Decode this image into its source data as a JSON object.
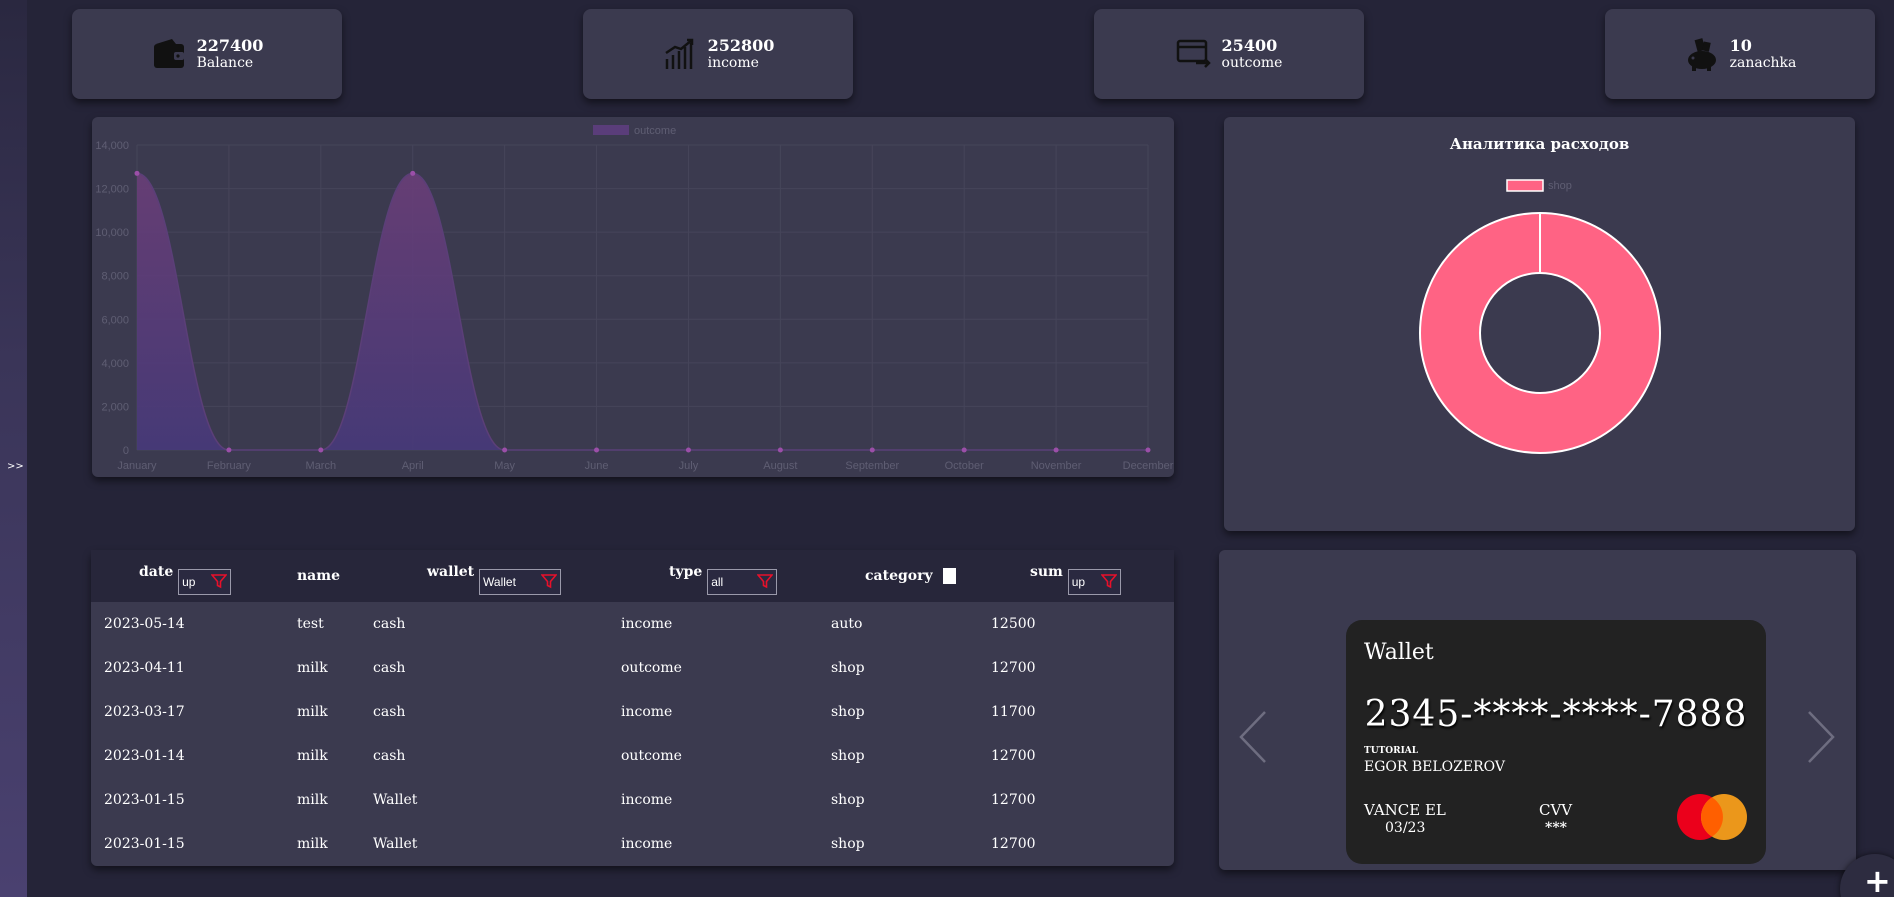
{
  "sidebar": {
    "toggle_label": ">>"
  },
  "stats": [
    {
      "value": "227400",
      "label": "Balance",
      "icon": "wallet-icon"
    },
    {
      "value": "252800",
      "label": "income",
      "icon": "growth-chart-icon"
    },
    {
      "value": "25400",
      "label": "outcome",
      "icon": "card-transfer-icon"
    },
    {
      "value": "10",
      "label": "zanachka",
      "icon": "piggy-bank-icon"
    }
  ],
  "line_chart_data": {
    "type": "area",
    "legend": "outcome",
    "categories": [
      "January",
      "February",
      "March",
      "April",
      "May",
      "June",
      "July",
      "August",
      "September",
      "October",
      "November",
      "December"
    ],
    "values": [
      12700,
      0,
      0,
      12700,
      0,
      0,
      0,
      0,
      0,
      0,
      0,
      0
    ],
    "y_ticks": [
      "0",
      "2,000",
      "4,000",
      "6,000",
      "8,000",
      "10,000",
      "12,000",
      "14,000"
    ],
    "ylim": [
      0,
      14000
    ],
    "grid": true,
    "color": "#5a3d7a"
  },
  "chart_data": {
    "type": "pie",
    "title": "Аналитика расходов",
    "categories": [
      "shop"
    ],
    "values": [
      25400
    ],
    "colors": [
      "#ff6384"
    ],
    "legend": "top"
  },
  "table": {
    "headers": {
      "date": "date",
      "name": "name",
      "wallet": "wallet",
      "type": "type",
      "category": "category",
      "sum": "sum"
    },
    "filters": {
      "date": "up",
      "wallet": "Wallet",
      "type": "all",
      "sum": "up"
    },
    "rows": [
      {
        "date": "2023-05-14",
        "name": "test",
        "wallet": "cash",
        "type": "income",
        "category": "auto",
        "sum": "12500"
      },
      {
        "date": "2023-04-11",
        "name": "milk",
        "wallet": "cash",
        "type": "outcome",
        "category": "shop",
        "sum": "12700"
      },
      {
        "date": "2023-03-17",
        "name": "milk",
        "wallet": "cash",
        "type": "income",
        "category": "shop",
        "sum": "11700"
      },
      {
        "date": "2023-01-14",
        "name": "milk",
        "wallet": "cash",
        "type": "outcome",
        "category": "shop",
        "sum": "12700"
      },
      {
        "date": "2023-01-15",
        "name": "milk",
        "wallet": "Wallet",
        "type": "income",
        "category": "shop",
        "sum": "12700"
      },
      {
        "date": "2023-01-15",
        "name": "milk",
        "wallet": "Wallet",
        "type": "income",
        "category": "shop",
        "sum": "12700"
      }
    ]
  },
  "wallet_card": {
    "title": "Wallet",
    "number": "2345-****-****-7888",
    "org": "TUTORIAL",
    "holder": "EGOR BELOZEROV",
    "owner": "VANCE EL",
    "expiry": "03/23",
    "cvv_label": "CVV",
    "cvv": "***"
  },
  "fab": {
    "label": "+"
  }
}
